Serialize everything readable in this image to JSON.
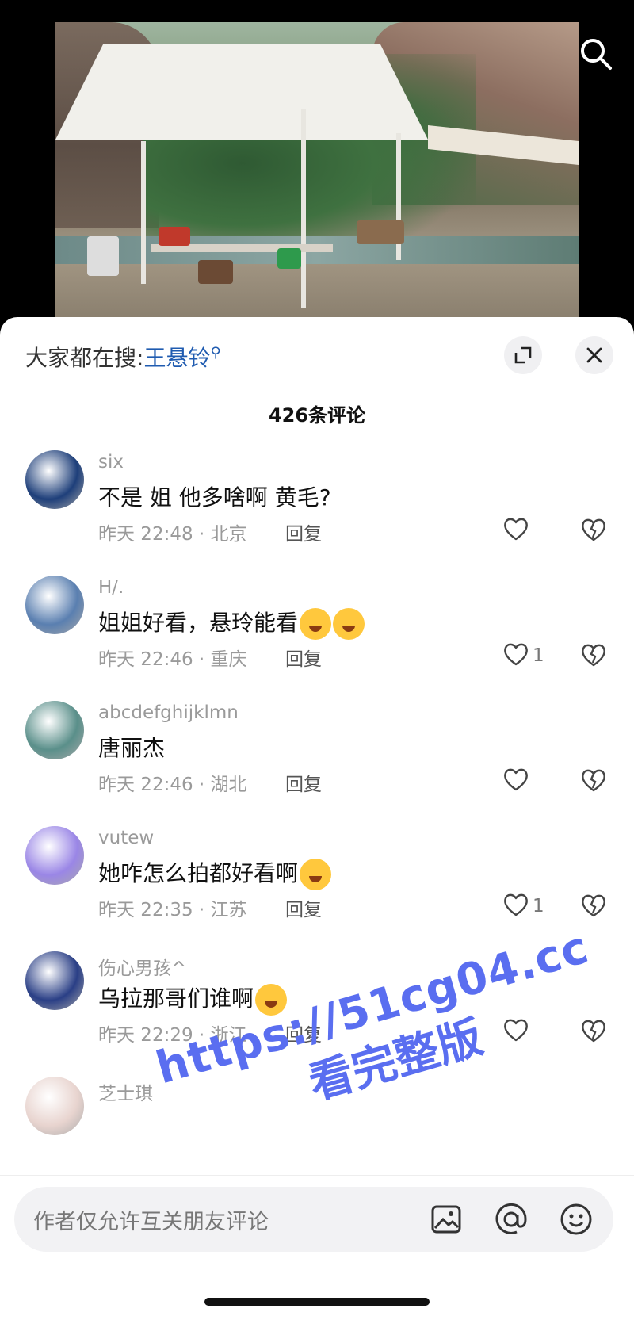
{
  "hot_search": {
    "prefix": "大家都在搜:",
    "keyword": "王悬铃",
    "search_glyph": "⚲"
  },
  "comment_count": "426条评论",
  "comments": [
    {
      "user": "six",
      "text": "不是 姐 他多啥啊 黄毛?",
      "meta": "昨天 22:48 · 北京",
      "reply": "回复",
      "likes": "",
      "avatar_color": "#1e3f7a",
      "emojis": 0
    },
    {
      "user": "H/.",
      "text": "姐姐好看，悬玲能看",
      "meta": "昨天 22:46 · 重庆",
      "reply": "回复",
      "likes": "1",
      "avatar_color": "#5a7fb0",
      "emojis": 2
    },
    {
      "user": "abcdefghijklmn",
      "text": "唐丽杰",
      "meta": "昨天 22:46 · 湖北",
      "reply": "回复",
      "likes": "",
      "avatar_color": "#5a8f8a",
      "emojis": 0
    },
    {
      "user": "vutew",
      "text": "她咋怎么拍都好看啊",
      "meta": "昨天 22:35 · 江苏",
      "reply": "回复",
      "likes": "1",
      "avatar_color": "#9a86e6",
      "emojis": 1
    },
    {
      "user": "伤心男孩^",
      "text": "乌拉那哥们谁啊",
      "meta": "昨天 22:29 · 浙江",
      "reply": "回复",
      "likes": "",
      "avatar_color": "#2a3f86",
      "emojis": 1
    },
    {
      "user": "芝士琪",
      "text": "",
      "meta": "",
      "reply": "",
      "likes": "",
      "avatar_color": "#e8d4cf",
      "emojis": 0
    }
  ],
  "input": {
    "placeholder": "作者仅允许互关朋友评论"
  },
  "watermark": {
    "line1": "https://51cg04.cc",
    "line2": "看完整版"
  },
  "colors": {
    "accent_blue": "#1f5bb0",
    "watermark": "#5a6ef0"
  },
  "icons": [
    "search-icon",
    "expand-icon",
    "close-icon",
    "heart-icon",
    "broken-heart-icon",
    "image-icon",
    "at-icon",
    "emoji-icon"
  ]
}
